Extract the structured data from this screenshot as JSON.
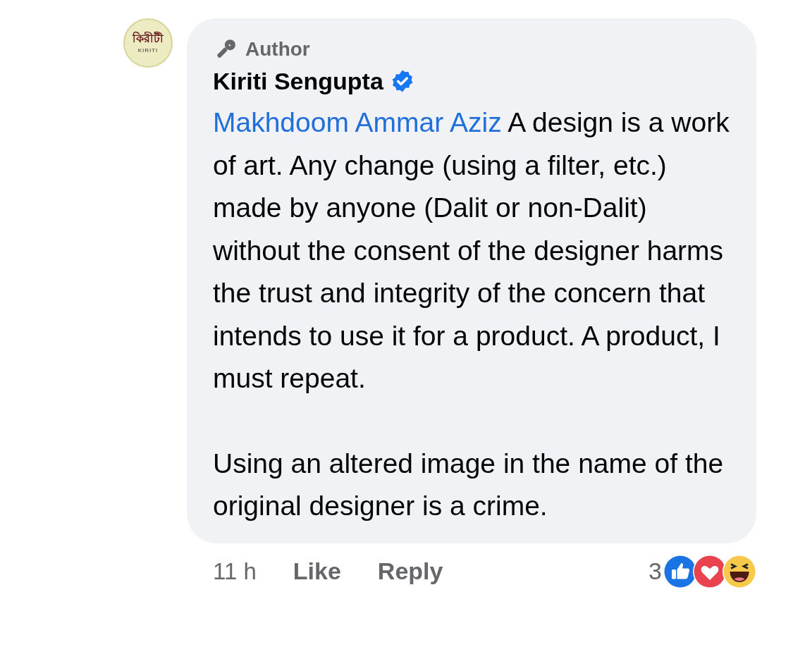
{
  "comment": {
    "avatar": {
      "title": "কিরীটী",
      "subtitle": "KIRITI"
    },
    "badge": "Author",
    "author": "Kiriti Sengupta",
    "verified": true,
    "mention": "Makhdoom Ammar Aziz",
    "paragraphs": [
      "A design is a work of art. Any change (using a filter, etc.) made by anyone (Dalit or non-Dalit) without the consent of the designer harms the trust and integrity of the concern that intends to use it for a product. A product, I must repeat.",
      "Using an altered image in the name of the original designer is a crime."
    ],
    "time": "11 h",
    "actions": [
      "Like",
      "Reply"
    ],
    "reaction_count": "3",
    "reactions": [
      {
        "kind": "like"
      },
      {
        "kind": "love"
      },
      {
        "kind": "haha"
      }
    ]
  }
}
